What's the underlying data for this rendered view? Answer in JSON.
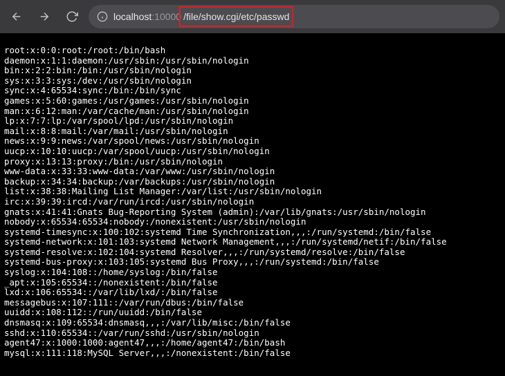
{
  "address": {
    "base": "localhost",
    "port": ":10000",
    "path": "/file/show.cgi/etc/passwd"
  },
  "file_lines": [
    "root:x:0:0:root:/root:/bin/bash",
    "daemon:x:1:1:daemon:/usr/sbin:/usr/sbin/nologin",
    "bin:x:2:2:bin:/bin:/usr/sbin/nologin",
    "sys:x:3:3:sys:/dev:/usr/sbin/nologin",
    "sync:x:4:65534:sync:/bin:/bin/sync",
    "games:x:5:60:games:/usr/games:/usr/sbin/nologin",
    "man:x:6:12:man:/var/cache/man:/usr/sbin/nologin",
    "lp:x:7:7:lp:/var/spool/lpd:/usr/sbin/nologin",
    "mail:x:8:8:mail:/var/mail:/usr/sbin/nologin",
    "news:x:9:9:news:/var/spool/news:/usr/sbin/nologin",
    "uucp:x:10:10:uucp:/var/spool/uucp:/usr/sbin/nologin",
    "proxy:x:13:13:proxy:/bin:/usr/sbin/nologin",
    "www-data:x:33:33:www-data:/var/www:/usr/sbin/nologin",
    "backup:x:34:34:backup:/var/backups:/usr/sbin/nologin",
    "list:x:38:38:Mailing List Manager:/var/list:/usr/sbin/nologin",
    "irc:x:39:39:ircd:/var/run/ircd:/usr/sbin/nologin",
    "gnats:x:41:41:Gnats Bug-Reporting System (admin):/var/lib/gnats:/usr/sbin/nologin",
    "nobody:x:65534:65534:nobody:/nonexistent:/usr/sbin/nologin",
    "systemd-timesync:x:100:102:systemd Time Synchronization,,,:/run/systemd:/bin/false",
    "systemd-network:x:101:103:systemd Network Management,,,:/run/systemd/netif:/bin/false",
    "systemd-resolve:x:102:104:systemd Resolver,,,:/run/systemd/resolve:/bin/false",
    "systemd-bus-proxy:x:103:105:systemd Bus Proxy,,,:/run/systemd:/bin/false",
    "syslog:x:104:108::/home/syslog:/bin/false",
    "_apt:x:105:65534::/nonexistent:/bin/false",
    "lxd:x:106:65534::/var/lib/lxd/:/bin/false",
    "messagebus:x:107:111::/var/run/dbus:/bin/false",
    "uuidd:x:108:112::/run/uuidd:/bin/false",
    "dnsmasq:x:109:65534:dnsmasq,,,:/var/lib/misc:/bin/false",
    "sshd:x:110:65534::/var/run/sshd:/usr/sbin/nologin",
    "agent47:x:1000:1000:agent47,,,:/home/agent47:/bin/bash",
    "mysql:x:111:118:MySQL Server,,,:/nonexistent:/bin/false"
  ]
}
